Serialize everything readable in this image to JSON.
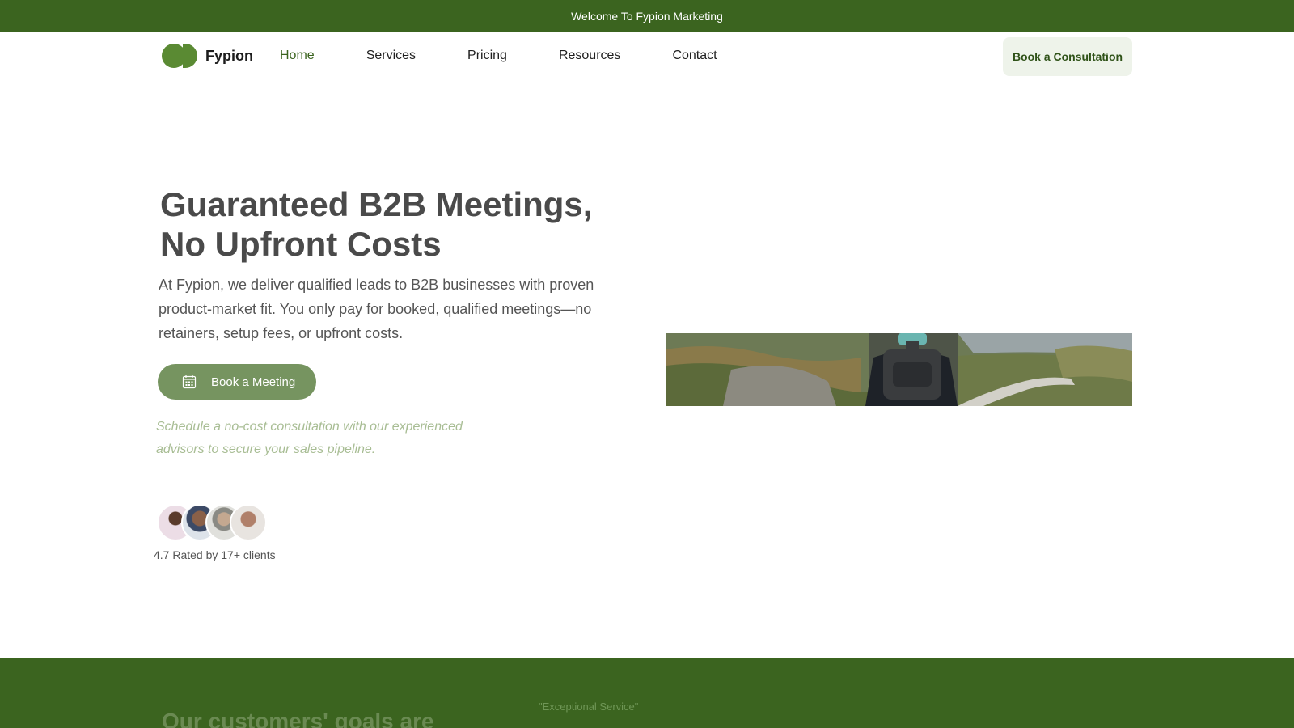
{
  "topbar": {
    "text": "Welcome To Fypion Marketing"
  },
  "brand": {
    "name": "Fypion",
    "accent": "#3b641f"
  },
  "nav": {
    "links": [
      {
        "label": "Home",
        "active": true
      },
      {
        "label": "Services"
      },
      {
        "label": "Pricing"
      },
      {
        "label": "Resources"
      },
      {
        "label": "Contact"
      }
    ],
    "cta": "Book a Consultation"
  },
  "hero": {
    "title_line1": "Guaranteed B2B Meetings,",
    "title_line2": "No Upfront Costs",
    "description": "At Fypion, we deliver qualified leads to B2B businesses with proven product-market fit. You only pay for booked, qualified meetings—no retainers, setup fees, or upfront costs.",
    "button_label": "Book a Meeting",
    "button_icon": "calendar-icon",
    "note": "Schedule a no-cost consultation with our experienced advisors to secure your sales pipeline.",
    "rating_text": "4.7 Rated by 17+ clients"
  },
  "band": {
    "heading": "Our customers' goals are",
    "quote": "\"Exceptional Service\""
  }
}
